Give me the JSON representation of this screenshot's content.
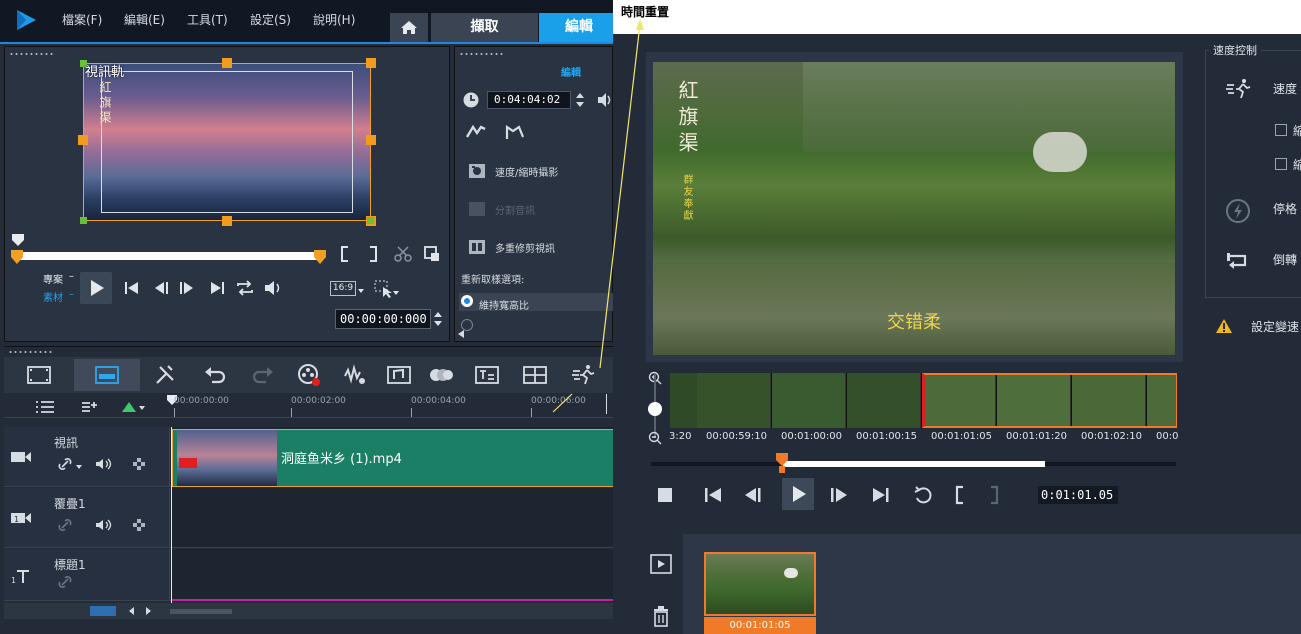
{
  "menu": {
    "file": "檔案(F)",
    "edit": "編輯(E)",
    "tools": "工具(T)",
    "settings": "設定(S)",
    "help": "說明(H)"
  },
  "tabs": {
    "capture": "擷取",
    "edit": "編輯"
  },
  "player": {
    "preview_label": "視訊軌",
    "preview_calligraphy": "紅旗渠",
    "project_label": "專案",
    "clip_label": "素材",
    "aspect": "16:9",
    "timecode": "00:00:00:000"
  },
  "options": {
    "title": "編輯",
    "duration": "0:04:04:02",
    "speed_timelapse": "速度/縮時攝影",
    "split_audio": "分割音訊",
    "multi_trim": "多重修剪視訊",
    "resample_label": "重新取樣選項:",
    "keep_aspect": "維持寬高比"
  },
  "timeline": {
    "ruler": [
      "00:00:00:00",
      "00:00:02:00",
      "00:00:04:00",
      "00:00:06:00"
    ],
    "tracks": [
      {
        "name": "視訊"
      },
      {
        "name": "覆疊1"
      },
      {
        "name": "標題1"
      }
    ],
    "clip_name": "洞庭鱼米乡 (1).mp4"
  },
  "trim": {
    "title": "時間重置",
    "calligraphy": "紅旗渠",
    "calligraphy_small": "群友奉獻",
    "subtitle": "交错柔",
    "frame_times": [
      "3:20",
      "00:00:59:10",
      "00:01:00:00",
      "00:01:00:15",
      "00:01:01:05",
      "00:01:01:20",
      "00:01:02:10",
      "00:0"
    ],
    "timecode": "0:01:01.05",
    "bin_timecode": "00:01:01:05"
  },
  "speed": {
    "group_title": "速度控制",
    "speed_label": "速度",
    "freeze_label": "停格",
    "reverse_label": "倒轉",
    "chk1": "縮",
    "chk2": "縮",
    "warning": "設定變速"
  },
  "colors": {
    "accent": "#19a0e8",
    "selection": "#f07a28",
    "clip_bg": "#1b7f66"
  }
}
